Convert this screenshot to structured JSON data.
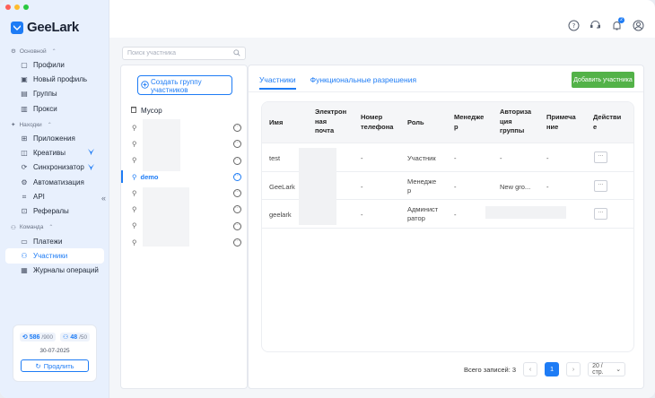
{
  "app": {
    "name": "GeeLark",
    "brand_color": "#1e7cf5"
  },
  "sidebar": {
    "sections": [
      {
        "label": "Основной",
        "items": [
          {
            "label": "Профили",
            "icon": "profiles-icon"
          },
          {
            "label": "Новый профиль",
            "icon": "new-profile-icon"
          },
          {
            "label": "Группы",
            "icon": "groups-icon"
          },
          {
            "label": "Прокси",
            "icon": "proxy-icon"
          }
        ]
      },
      {
        "label": "Находки",
        "items": [
          {
            "label": "Приложения",
            "icon": "apps-icon"
          },
          {
            "label": "Креативы",
            "icon": "creatives-icon",
            "badge": "bird-icon"
          },
          {
            "label": "Синхронизатор",
            "icon": "sync-icon",
            "badge": "bird-icon"
          },
          {
            "label": "Автоматизация",
            "icon": "automation-icon"
          },
          {
            "label": "API",
            "icon": "api-icon"
          },
          {
            "label": "Рефералы",
            "icon": "referral-icon"
          }
        ]
      },
      {
        "label": "Команда",
        "items": [
          {
            "label": "Платежи",
            "icon": "payments-icon"
          },
          {
            "label": "Участники",
            "icon": "members-icon",
            "active": true
          },
          {
            "label": "Журналы операций",
            "icon": "logs-icon"
          }
        ]
      }
    ],
    "quota": {
      "profiles_used": "586",
      "profiles_total": "/900",
      "members_used": "48",
      "members_total": "/50"
    },
    "expiry_date": "30-07-2025",
    "renew_label": "Продлить"
  },
  "header": {
    "notification_count": "2"
  },
  "groups": {
    "search_placeholder": "Поиск участника",
    "create_label_1": "Создать группу",
    "create_label_2": "участников",
    "trash_label": "Мусор",
    "items": [
      {
        "label": ""
      },
      {
        "label": ""
      },
      {
        "label": ""
      },
      {
        "label": "demo",
        "active": true
      },
      {
        "label": ""
      },
      {
        "label": ""
      },
      {
        "label": ""
      },
      {
        "label": ""
      }
    ]
  },
  "members": {
    "tabs": [
      "Участники",
      "Функциональные разрешения"
    ],
    "add_button": "Добавить участника",
    "columns": {
      "name": "Имя",
      "email": [
        "Электрон",
        "ная",
        "почта"
      ],
      "phone": [
        "Номер",
        "телефона"
      ],
      "role": "Роль",
      "manager": [
        "Менедже",
        "р"
      ],
      "auth": [
        "Авториза",
        "ция",
        "группы"
      ],
      "note": [
        "Примеча",
        "ние"
      ],
      "action": [
        "Действи",
        "е"
      ]
    },
    "rows": [
      {
        "name": "test",
        "phone": "-",
        "role": [
          "Участник"
        ],
        "manager": "-",
        "auth": "-",
        "note": "-"
      },
      {
        "name": "GeeLark",
        "phone": "-",
        "role": [
          "Менедже",
          "р"
        ],
        "manager": "-",
        "auth": "New gro...",
        "note": "-"
      },
      {
        "name": "geelark",
        "phone": "-",
        "role": [
          "Админист",
          "ратор"
        ],
        "manager": "-",
        "auth": "",
        "note": ""
      }
    ],
    "action_label": "···",
    "pagination": {
      "total_label": "Всего записей: 3",
      "current_page": "1",
      "page_size": "20 / стр."
    }
  }
}
